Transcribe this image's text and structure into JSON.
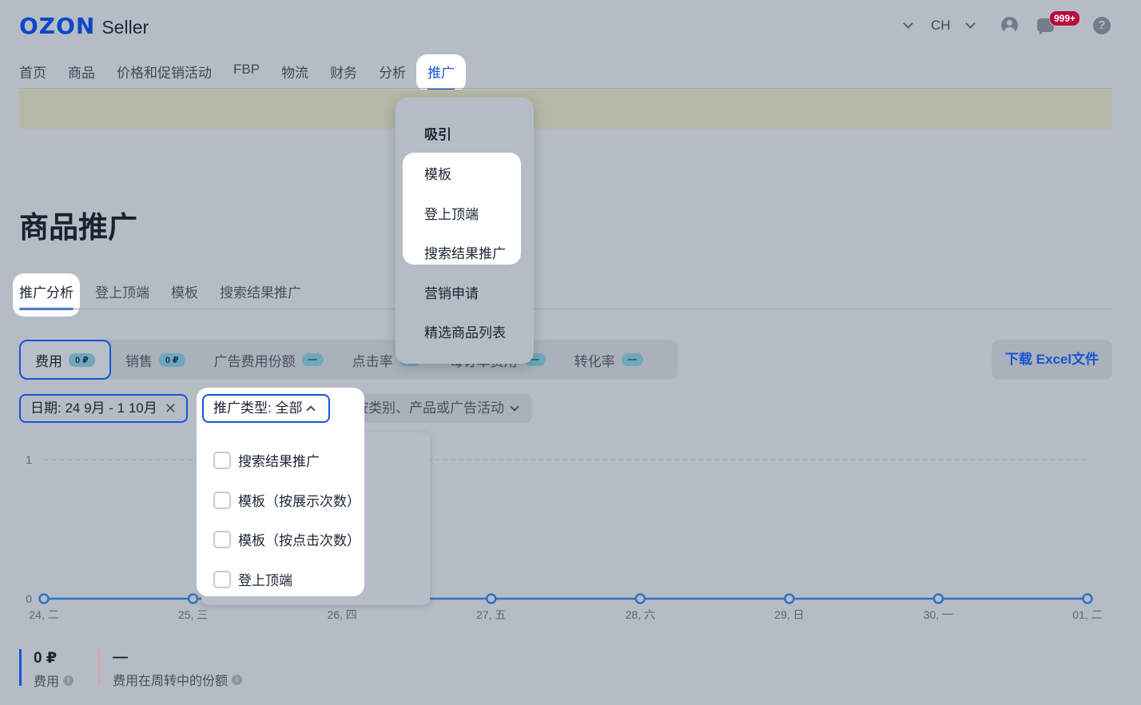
{
  "header": {
    "logo_main": "OZON",
    "logo_sub": "Seller",
    "lang": "CH",
    "notification_badge": "999+"
  },
  "nav": {
    "items": [
      "首页",
      "商品",
      "价格和促销活动",
      "FBP",
      "物流",
      "财务",
      "分析"
    ],
    "active": "推广"
  },
  "promo_menu": {
    "section1": "吸引",
    "items": [
      "模板",
      "登上顶端",
      "搜索结果推广"
    ],
    "section2": "营销申请",
    "section3": "精选商品列表"
  },
  "page": {
    "title": "商品推广"
  },
  "subtabs": {
    "active": "推广分析",
    "items": [
      "登上顶端",
      "模板",
      "搜索结果推广"
    ]
  },
  "metrics": [
    {
      "label": "费用",
      "pill": "0 ₽"
    },
    {
      "label": "销售",
      "pill": "0 ₽"
    },
    {
      "label": "广告费用份额",
      "pill": "—"
    },
    {
      "label": "点击率",
      "pill": "—"
    },
    {
      "label": "每订单费用",
      "pill": "—"
    },
    {
      "label": "转化率",
      "pill": "—"
    }
  ],
  "excel_button": "下载 Excel文件",
  "filters": {
    "date": "日期: 24 9月 - 1 10月",
    "type": "推广类型: 全部",
    "category": "按类别、产品或广告活动"
  },
  "type_options": [
    "搜索结果推广",
    "模板（按展示次数）",
    "模板（按点击次数）",
    "登上顶端"
  ],
  "chart_data": {
    "type": "line",
    "categories": [
      "24, 二",
      "25, 三",
      "26, 四",
      "27, 五",
      "28, 六",
      "29, 日",
      "30, 一",
      "01, 二"
    ],
    "series": [
      {
        "values": [
          0,
          0,
          0,
          0,
          0,
          0,
          0,
          0
        ]
      }
    ],
    "y_ticks": [
      "1",
      "0"
    ],
    "ylim": [
      0,
      1
    ],
    "grid": true,
    "color": "#2d73c4"
  },
  "stats": [
    {
      "value": "0 ₽",
      "label": "费用"
    },
    {
      "value": "—",
      "label": "费用在周转中的份额"
    }
  ]
}
